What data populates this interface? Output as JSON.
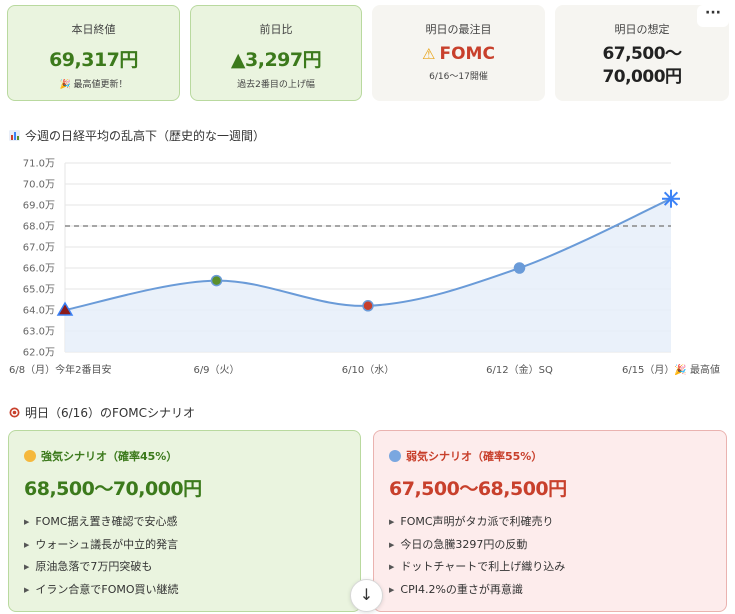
{
  "cards": [
    {
      "label": "本日終値",
      "value": "69,317円",
      "sub": "🎉 最高値更新！"
    },
    {
      "label": "前日比",
      "value": "▲3,297円",
      "sub": "過去2番目の上げ幅"
    },
    {
      "label": "明日の最注目",
      "value": "FOMC",
      "sub": "6/16〜17開催",
      "icon": "warning-icon"
    },
    {
      "label": "明日の想定",
      "value_line1": "67,500〜",
      "value_line2": "70,000円"
    }
  ],
  "menu_label": "···",
  "chart_section_title": "今週の日経平均の乱高下（歴史的な一週間）",
  "chart_data": {
    "type": "line",
    "categories": [
      "6/8（月）今年2番目安",
      "6/9（火）",
      "6/10（水）",
      "6/12（金）SQ",
      "6/15（月）🎉 最高値"
    ],
    "series": [
      {
        "values": [
          64.0,
          65.4,
          64.2,
          66.0,
          69.3
        ]
      }
    ],
    "marker_colors": [
      "#8b1a1a",
      "#5a8f2a",
      "#c8402c",
      "#6a9bd8",
      "#3b82f6"
    ],
    "reference_line": 68.0,
    "yticks": [
      "71.0万",
      "70.0万",
      "69.0万",
      "68.0万",
      "67.0万",
      "66.0万",
      "65.0万",
      "64.0万",
      "63.0万",
      "62.0万"
    ],
    "ylim": [
      62.0,
      71.0
    ],
    "grid": true
  },
  "scenario_section_title": "明日（6/16）のFOMCシナリオ",
  "bull": {
    "heading": "強気シナリオ（確率45%）",
    "range": "68,500〜70,000円",
    "items": [
      "FOMC据え置き確認で安心感",
      "ウォーシュ議長が中立的発言",
      "原油急落で7万円突破も",
      "イラン合意でFOMO買い継続"
    ]
  },
  "bear": {
    "heading": "弱気シナリオ（確率55%）",
    "range": "67,500〜68,500円",
    "items": [
      "FOMC声明がタカ派で利確売り",
      "今日の急騰3297円の反動",
      "ドットチャートで利上げ織り込み",
      "CPI4.2%の重さが再意識"
    ]
  },
  "scroll_label": "↓"
}
